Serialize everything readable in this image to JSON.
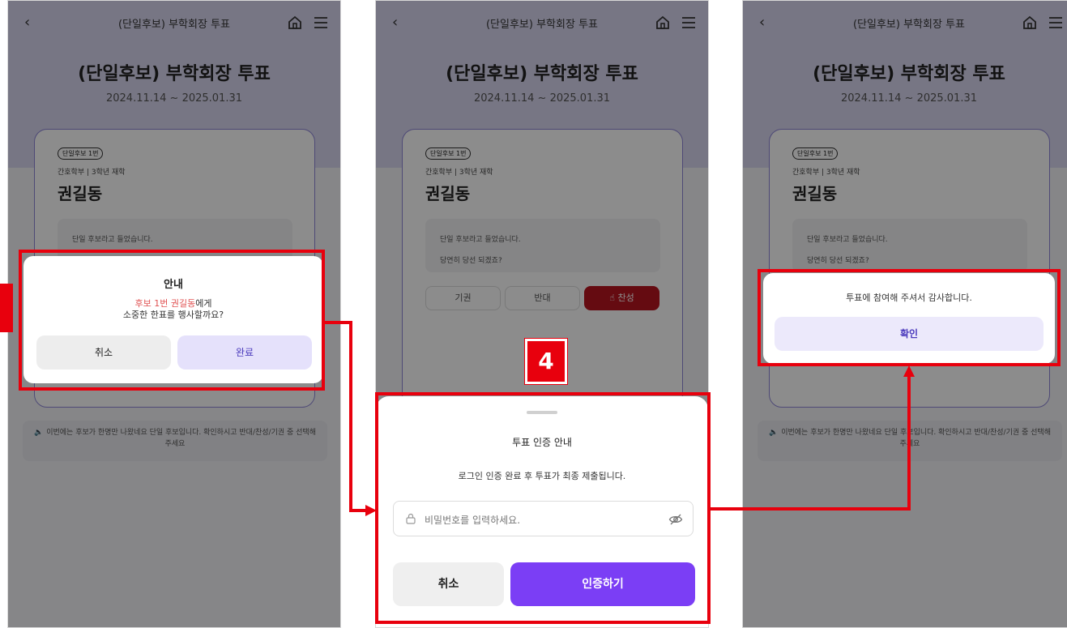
{
  "header": {
    "back_icon": "‹",
    "title": "(단일후보) 부학회장 투표"
  },
  "poll": {
    "title": "(단일후보) 부학회장 투표",
    "period": "2024.11.14 ~ 2025.01.31"
  },
  "candidate": {
    "badge": "단일후보 1번",
    "dept": "간호학부 | 3학년 재학",
    "name": "권길동",
    "desc_line1": "단일 후보라고 들었습니다.",
    "desc_line2": "당연히 당선 되겠죠?"
  },
  "vote_buttons": {
    "abstain": "기권",
    "oppose": "반대",
    "approve": "찬성",
    "approve_icon": "thumbs-up-icon"
  },
  "notice": {
    "icon": "🔈",
    "text": "이번에는 후보가 한명만 나왔네요 단일 후보입니다. 확인하시고 반대/찬성/기권 중 선택해주세요"
  },
  "confirm_modal": {
    "title": "안내",
    "candidate_highlight": "후보 1번 권길동",
    "line1_suffix": "에게",
    "line2": "소중한 한표를 행사할까요?",
    "cancel": "취소",
    "complete": "완료"
  },
  "step": {
    "number": "4"
  },
  "auth_sheet": {
    "title": "투표 인증 안내",
    "message": "로그인 인증 완료 후 투표가 최종 제출됩니다.",
    "password_placeholder": "비밀번호를 입력하세요.",
    "cancel": "취소",
    "submit": "인증하기"
  },
  "thanks_modal": {
    "message": "투표에 참여해 주셔서 감사합니다.",
    "confirm": "확인"
  },
  "colors": {
    "highlight_red": "#e8000d",
    "primary_purple": "#7b3ef5",
    "approve_red": "#b8141f",
    "hero_bg": "#d9d7f0"
  }
}
